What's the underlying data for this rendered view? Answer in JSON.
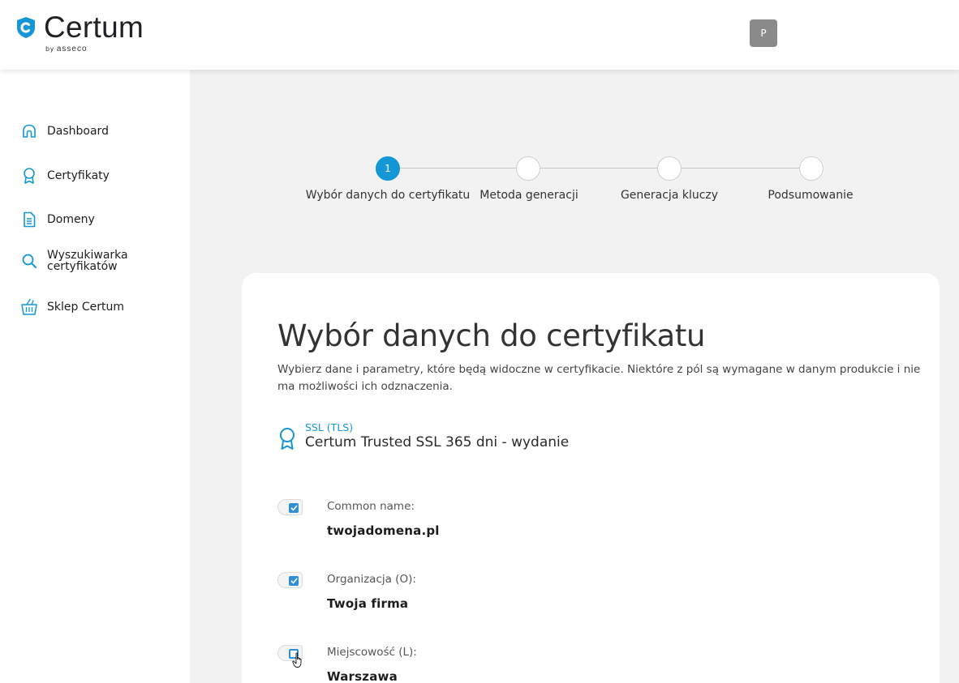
{
  "header": {
    "logo": {
      "name": "Certum",
      "by": "by",
      "brand": "asseco"
    },
    "avatar_initial": "P"
  },
  "sidebar": {
    "items": [
      {
        "label": "Dashboard",
        "icon": "home-icon"
      },
      {
        "label": "Certyfikaty",
        "icon": "award-icon"
      },
      {
        "label": "Domeny",
        "icon": "document-icon"
      },
      {
        "label": "Wyszukiwarka certyfikatów",
        "icon": "search-icon"
      },
      {
        "label": "Sklep Certum",
        "icon": "basket-icon"
      }
    ]
  },
  "stepper": {
    "steps": [
      {
        "number": "1",
        "label": "Wybór danych do certyfikatu",
        "active": true
      },
      {
        "number": "",
        "label": "Metoda generacji",
        "active": false
      },
      {
        "number": "",
        "label": "Generacja kluczy",
        "active": false
      },
      {
        "number": "",
        "label": "Podsumowanie",
        "active": false
      }
    ]
  },
  "card": {
    "title": "Wybór danych do certyfikatu",
    "description": "Wybierz dane i parametry, które będą widoczne w certyfikacie. Niektóre z pól są wymagane w danym produkcie i nie ma możliwości ich odznaczenia.",
    "product": {
      "type": "SSL (TLS)",
      "name": "Certum Trusted SSL 365 dni - wydanie"
    },
    "fields": [
      {
        "label": "Common name:",
        "value": "twojadomena.pl",
        "checked": true
      },
      {
        "label": "Organizacja (O):",
        "value": "Twoja firma",
        "checked": true
      },
      {
        "label": "Miejscowość (L):",
        "value": "Warszawa",
        "checked": false
      }
    ]
  },
  "colors": {
    "accent": "#1596d6",
    "checkbox": "#2e8fd4",
    "background": "#f2f2f2"
  }
}
